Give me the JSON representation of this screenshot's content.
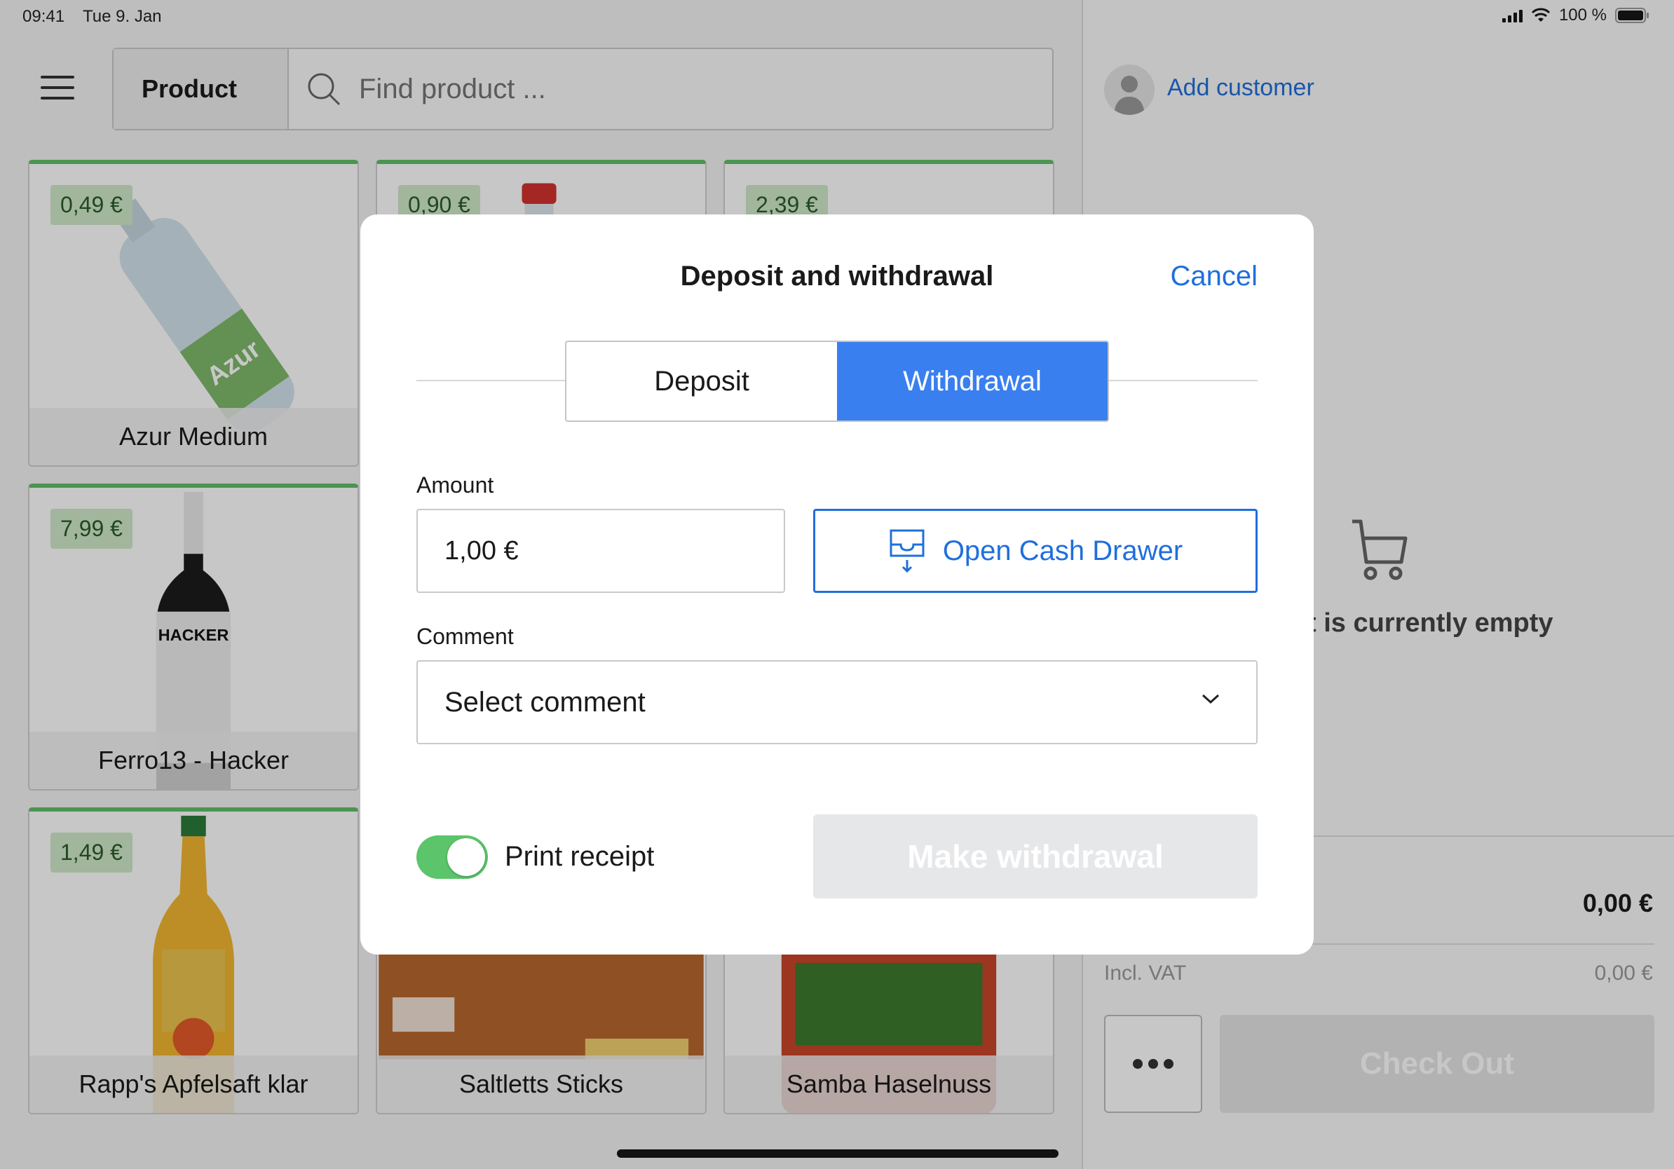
{
  "status_bar": {
    "time": "09:41",
    "date": "Tue 9. Jan",
    "battery": "100 %"
  },
  "search": {
    "type_label": "Product",
    "placeholder": "Find product ..."
  },
  "products": [
    {
      "price": "0,49 €",
      "name": "Azur Medium"
    },
    {
      "price": "0,90 €",
      "name": ""
    },
    {
      "price": "2,39 €",
      "name": ""
    },
    {
      "price": "7,99 €",
      "name": "Ferro13 - Hacker"
    },
    {
      "price": "1,49 €",
      "name": "Rapp's Apfelsaft klar"
    },
    {
      "price": "",
      "name": "Saltletts Sticks"
    },
    {
      "price": "",
      "name": "Samba Haselnuss"
    }
  ],
  "customer": {
    "add_label": "Add customer"
  },
  "cart": {
    "empty_text": "t is currently empty",
    "total": "0,00 €",
    "vat_label": "Incl. VAT",
    "vat_value": "0,00 €",
    "checkout_label": "Check Out"
  },
  "modal": {
    "title": "Deposit and withdrawal",
    "cancel_label": "Cancel",
    "segments": {
      "deposit": "Deposit",
      "withdrawal": "Withdrawal"
    },
    "amount_label": "Amount",
    "amount_value": "1,00 €",
    "open_drawer_label": "Open Cash Drawer",
    "comment_label": "Comment",
    "comment_placeholder": "Select comment",
    "print_receipt_label": "Print receipt",
    "print_receipt_on": true,
    "submit_label": "Make withdrawal"
  },
  "colors": {
    "accent": "#3a7ff0",
    "link": "#1f6fdc",
    "toggle_on": "#5cc46a",
    "price_tag": "#cfe9c9",
    "tile_top": "#5fbf6a"
  }
}
